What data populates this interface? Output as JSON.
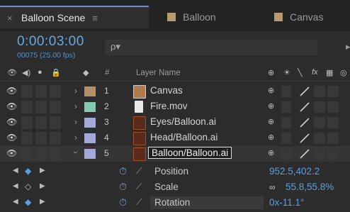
{
  "tabs": [
    {
      "label": "Balloon Scene",
      "active": true,
      "swatch": "#ffffff00"
    },
    {
      "label": "Balloon",
      "active": false,
      "swatch": "#b79b6e"
    },
    {
      "label": "Canvas",
      "active": false,
      "swatch": "#b79b6e"
    }
  ],
  "header": {
    "timecode": "0:00:03:00",
    "frames": "00075 (25.00 fps)",
    "search_icon_text": "ρ▾"
  },
  "columns": {
    "layer_name": "Layer Name",
    "number": "#"
  },
  "layers": [
    {
      "num": "1",
      "name": "Canvas",
      "label_color": "#b08f6b",
      "icon": "image-icon",
      "icon_color": "#b07a4c"
    },
    {
      "num": "2",
      "name": "Fire.mov",
      "label_color": "#87c7b8",
      "icon": "video-file-icon",
      "icon_color": "#e8e8e8"
    },
    {
      "num": "3",
      "name": "Eyes/Balloon.ai",
      "label_color": "#a2a8d8",
      "icon": "illustrator-file-icon",
      "icon_color": "#a0502a"
    },
    {
      "num": "4",
      "name": "Head/Balloon.ai",
      "label_color": "#a2a8d8",
      "icon": "illustrator-file-icon",
      "icon_color": "#a0502a"
    },
    {
      "num": "5",
      "name": "Balloon/Balloon.ai",
      "label_color": "#a2a8d8",
      "icon": "illustrator-file-icon",
      "icon_color": "#a0502a"
    }
  ],
  "properties": [
    {
      "name": "Position",
      "value": "952.5,402.2"
    },
    {
      "name": "Scale",
      "value": "55.8,55.8%"
    },
    {
      "name": "Rotation",
      "value": "0x-11.1°"
    }
  ],
  "colors": {
    "accent": "#66aae6",
    "value_blue": "#5b9fe0"
  }
}
